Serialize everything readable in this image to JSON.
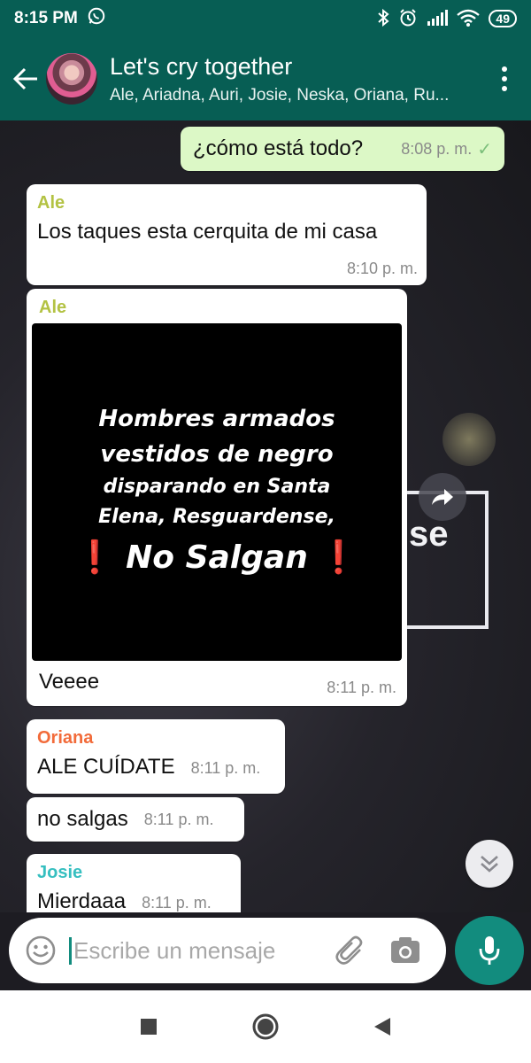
{
  "status_bar": {
    "time": "8:15 PM",
    "battery": "49",
    "icons": [
      "whatsapp-icon",
      "bluetooth-icon",
      "alarm-icon",
      "signal-icon",
      "wifi-icon",
      "battery-icon"
    ]
  },
  "header": {
    "title": "Let's cry together",
    "members": "Ale, Ariadna, Auri, Josie, Neska, Oriana, Ru..."
  },
  "colors": {
    "header_bg": "#075e54",
    "outgoing_bubble": "#dcf8c6",
    "accent": "#128c7e",
    "sender_ale": "#b3c243",
    "sender_oriana": "#f26b3a",
    "sender_josie": "#36bfc0"
  },
  "messages": [
    {
      "direction": "out",
      "text": "¿cómo está todo?",
      "time": "8:08 p. m.",
      "status": "sent"
    },
    {
      "direction": "in",
      "sender": "Ale",
      "text": "Los taques esta cerquita de mi casa",
      "time": "8:10 p. m."
    },
    {
      "direction": "in",
      "sender": "Ale",
      "caption": "Veeee",
      "time": "8:11 p. m.",
      "media": {
        "line1": "Hombres armados",
        "line2": "vestidos de negro",
        "line3": "disparando en Santa",
        "line4": "Elena, Resguardense,",
        "line5": "No Salgan",
        "exclamation": "❗"
      }
    },
    {
      "direction": "in",
      "sender": "Oriana",
      "text": "ALE CUÍDATE",
      "time": "8:11 p. m."
    },
    {
      "direction": "in",
      "text": "no salgas",
      "time": "8:11 p. m."
    },
    {
      "direction": "in",
      "sender": "Josie",
      "text": "Mierdaaa",
      "time": "8:11 p. m."
    }
  ],
  "background_text": "se",
  "input": {
    "placeholder": "Escribe un mensaje"
  }
}
